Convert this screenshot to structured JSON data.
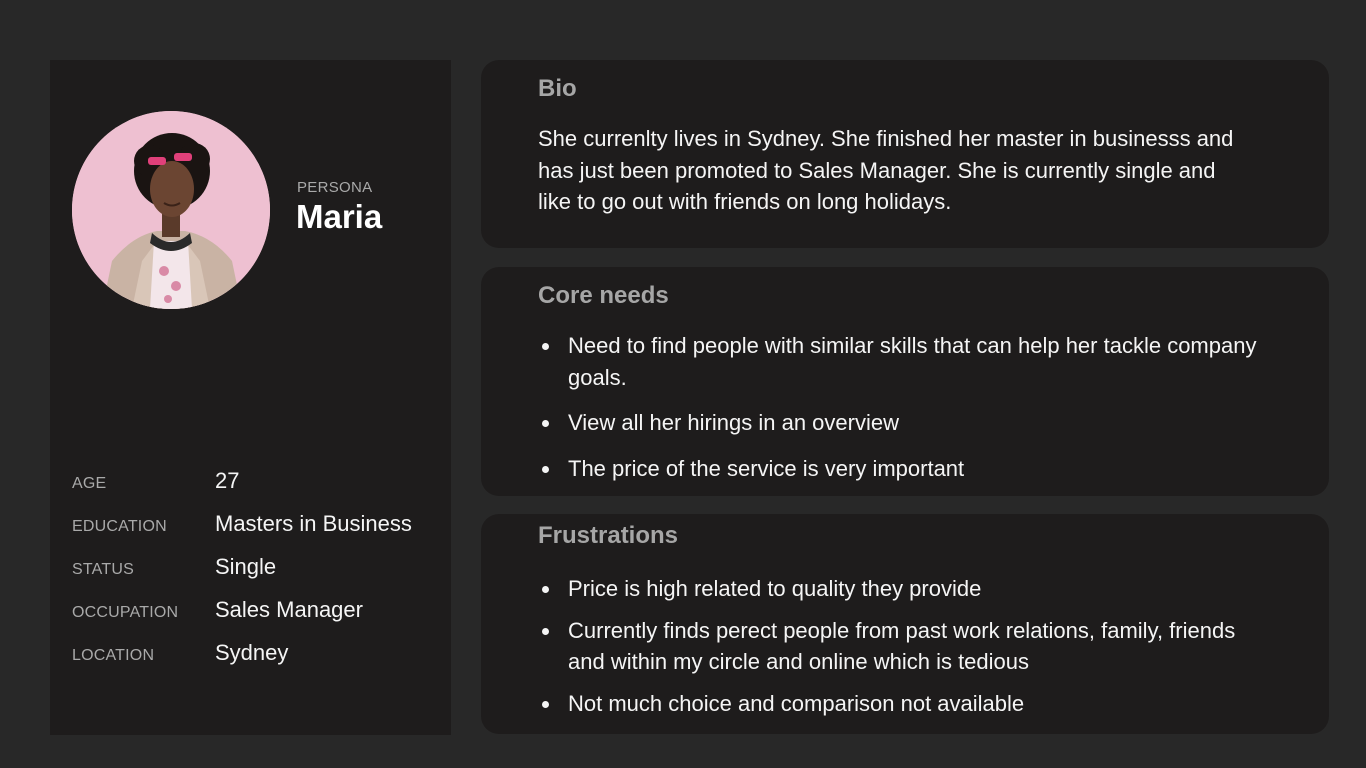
{
  "profile": {
    "persona_label": "PERSONA",
    "name": "Maria",
    "details": [
      {
        "key": "AGE",
        "value": "27"
      },
      {
        "key": "EDUCATION",
        "value": "Masters in Business"
      },
      {
        "key": "STATUS",
        "value": "Single"
      },
      {
        "key": "OCCUPATION",
        "value": "Sales Manager"
      },
      {
        "key": "LOCATION",
        "value": "Sydney"
      }
    ]
  },
  "bio": {
    "title": "Bio",
    "text": "She currenlty lives in Sydney. She finished her master in businesss and has just been promoted to Sales Manager. She is currently single and like to go out with friends on long holidays."
  },
  "core_needs": {
    "title": "Core needs",
    "items": [
      "Need to find people with similar skills that can help her tackle company goals.",
      "View all her hirings in an overview",
      "The price of the service is very important"
    ]
  },
  "frustrations": {
    "title": "Frustrations",
    "items": [
      "Price is high related to quality they provide",
      "Currently finds perect people from past work relations, family, friends and within my circle and online which is tedious",
      "Not much choice and comparison not available"
    ]
  },
  "colors": {
    "background": "#282828",
    "card": "#1e1c1c",
    "title_gray": "#a6a6a6",
    "label_gray": "#a9a9a9",
    "text": "#f5f5f5",
    "avatar_bg": "#eebfd0"
  }
}
